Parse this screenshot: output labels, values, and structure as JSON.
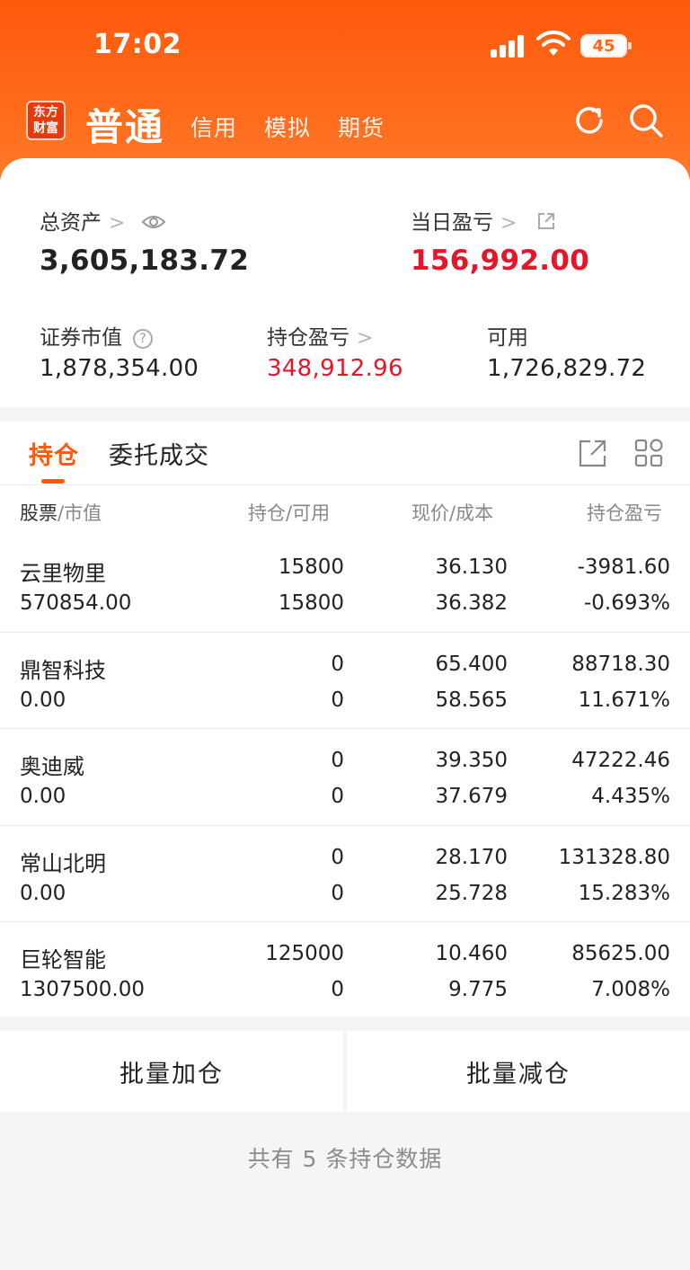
{
  "status": {
    "time": "17:02",
    "battery": "45"
  },
  "nav": {
    "logo_line1": "东方",
    "logo_line2": "财富",
    "main_tab": "普通",
    "tabs": [
      "信用",
      "模拟",
      "期货"
    ]
  },
  "summary": {
    "total_assets_label": "总资产",
    "total_assets_value": "3,605,183.72",
    "daily_pl_label": "当日盈亏",
    "daily_pl_value": "156,992.00",
    "market_value_label": "证券市值",
    "market_value_value": "1,878,354.00",
    "position_pl_label": "持仓盈亏",
    "position_pl_value": "348,912.96",
    "available_label": "可用",
    "available_value": "1,726,829.72"
  },
  "tabs": {
    "positions": "持仓",
    "orders": "委托成交"
  },
  "table": {
    "headers": {
      "stock": "股票",
      "stock_sub": "市值",
      "hold": "持仓",
      "hold_sub": "可用",
      "price": "现价",
      "price_sub": "成本",
      "pl": "持仓盈亏"
    },
    "rows": [
      {
        "name": "云里物里",
        "market_value": "570854.00",
        "hold": "15800",
        "available": "15800",
        "price": "36.130",
        "cost": "36.382",
        "pl": "-3981.60",
        "pl_pct": "-0.693%",
        "trend": "down"
      },
      {
        "name": "鼎智科技",
        "market_value": "0.00",
        "hold": "0",
        "available": "0",
        "price": "65.400",
        "cost": "58.565",
        "pl": "88718.30",
        "pl_pct": "11.671%",
        "trend": "up"
      },
      {
        "name": "奥迪威",
        "market_value": "0.00",
        "hold": "0",
        "available": "0",
        "price": "39.350",
        "cost": "37.679",
        "pl": "47222.46",
        "pl_pct": "4.435%",
        "trend": "up"
      },
      {
        "name": "常山北明",
        "market_value": "0.00",
        "hold": "0",
        "available": "0",
        "price": "28.170",
        "cost": "25.728",
        "pl": "131328.80",
        "pl_pct": "15.283%",
        "trend": "up"
      },
      {
        "name": "巨轮智能",
        "market_value": "1307500.00",
        "hold": "125000",
        "available": "0",
        "price": "10.460",
        "cost": "9.775",
        "pl": "85625.00",
        "pl_pct": "7.008%",
        "trend": "up"
      }
    ]
  },
  "actions": {
    "batch_add": "批量加仓",
    "batch_reduce": "批量减仓"
  },
  "footer": "共有 5 条持仓数据",
  "colors": {
    "brand": "#ff5a0c",
    "up": "#e5162a",
    "down": "#2e9c31"
  },
  "icons": [
    "eye-icon",
    "external-link-icon",
    "help-icon",
    "refresh-icon",
    "search-icon",
    "share-icon",
    "grid-icon"
  ]
}
